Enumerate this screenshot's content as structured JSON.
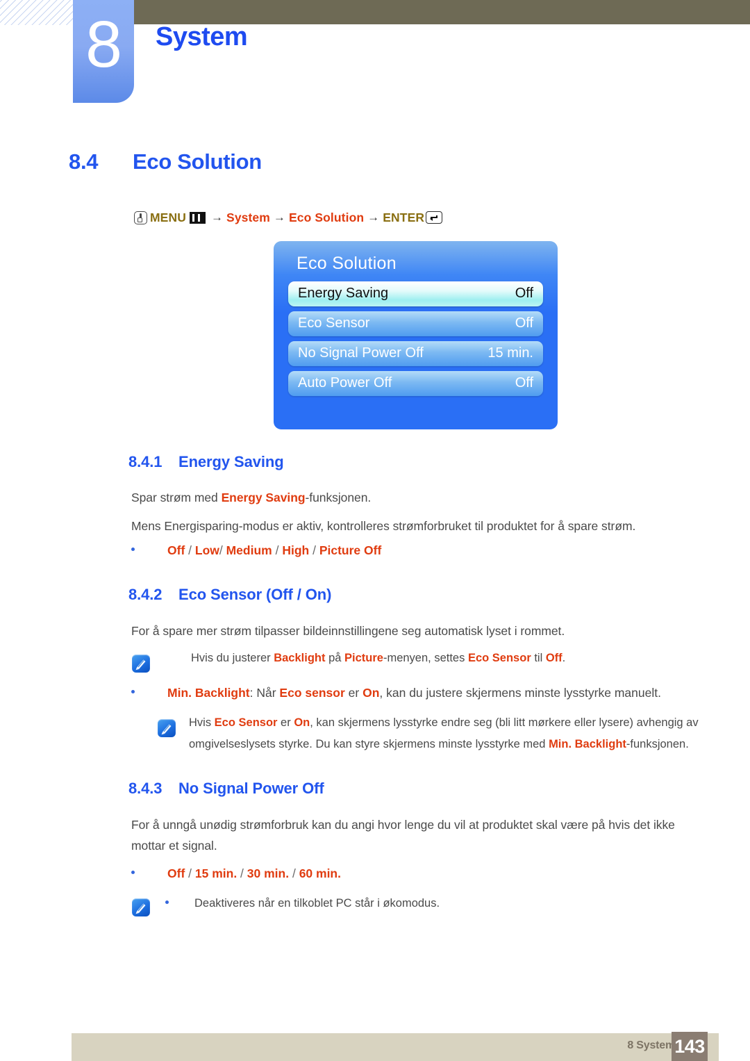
{
  "header": {
    "chapter_number": "8",
    "chapter_title": "System",
    "olive_bar_color": "#6e6a55",
    "tab_color": "#6f9bf0",
    "title_color": "#1e4bf0"
  },
  "section": {
    "number": "8.4",
    "title": "Eco Solution"
  },
  "menu_path": {
    "hand_icon": "hand-press-icon",
    "menu_label": "MENU",
    "menu_icon": "menu-bars-icon",
    "arrow": "→",
    "step_system": "System",
    "step_eco_solution": "Eco Solution",
    "enter_label": "ENTER",
    "enter_icon": "enter-return-icon",
    "gold_color": "#8a6f12",
    "red_color": "#e03c10"
  },
  "osd": {
    "title": "Eco Solution",
    "rows": [
      {
        "label": "Energy Saving",
        "value": "Off",
        "selected": true
      },
      {
        "label": "Eco Sensor",
        "value": "Off",
        "selected": false
      },
      {
        "label": "No Signal Power Off",
        "value": "15 min.",
        "selected": false
      },
      {
        "label": "Auto Power Off",
        "value": "Off",
        "selected": false
      }
    ]
  },
  "sub1": {
    "number": "8.4.1",
    "title": "Energy Saving",
    "para1_a": "Spar strøm med ",
    "para1_b": "Energy Saving",
    "para1_c": "-funksjonen.",
    "para2": "Mens Energisparing-modus er aktiv, kontrolleres strømforbruket til produktet for å spare strøm.",
    "options": {
      "o1": "Off",
      "o2": "Low",
      "o3": "Medium",
      "o4": "High",
      "o5": "Picture Off",
      "s1": " / ",
      "s2": "/ ",
      "s3": " / ",
      "s4": " / "
    }
  },
  "sub2": {
    "number": "8.4.2",
    "title": "Eco Sensor (Off / On)",
    "para1": "For å spare mer strøm tilpasser bildeinnstillingene seg automatisk lyset i rommet.",
    "note1": {
      "icon": "note-pen-icon",
      "a": "Hvis du justerer ",
      "b1": "Backlight",
      "c": " på ",
      "b2": "Picture",
      "d": "-menyen, settes ",
      "b3": "Eco Sensor",
      "e": " til ",
      "b4": "Off",
      "f": "."
    },
    "bullet1": {
      "b1": "Min. Backlight",
      "a": ": Når ",
      "b2": "Eco sensor",
      "b": " er ",
      "b3": "On",
      "c": ", kan du justere skjermens minste lysstyrke manuelt."
    },
    "note2": {
      "icon": "note-pen-icon",
      "a": "Hvis ",
      "b1": "Eco Sensor",
      "b": " er ",
      "b2": "On",
      "c": ", kan skjermens lysstyrke endre seg (bli litt mørkere eller lysere) avhengig av",
      "line2_a": "omgivelseslysets styrke. Du kan styre skjermens minste lysstyrke med ",
      "line2_b": "Min. Backlight",
      "line2_c": "-funksjonen."
    }
  },
  "sub3": {
    "number": "8.4.3",
    "title": "No Signal Power Off",
    "para1_line1": "For å unngå unødig strømforbruk kan du angi hvor lenge du vil at produktet skal være på hvis det ikke",
    "para1_line2": "mottar et signal.",
    "options": {
      "o1": "Off",
      "o2": "15 min.",
      "o3": "30 min.",
      "o4": "60 min.",
      "s1": " / ",
      "s2": " / ",
      "s3": " / "
    },
    "note1": {
      "icon": "note-pen-icon",
      "text": "Deaktiveres når en tilkoblet PC står i økomodus."
    }
  },
  "footer": {
    "text": "8 System",
    "page": "143",
    "band_color": "#d8d3c0",
    "page_box_color": "#8a7d72"
  }
}
